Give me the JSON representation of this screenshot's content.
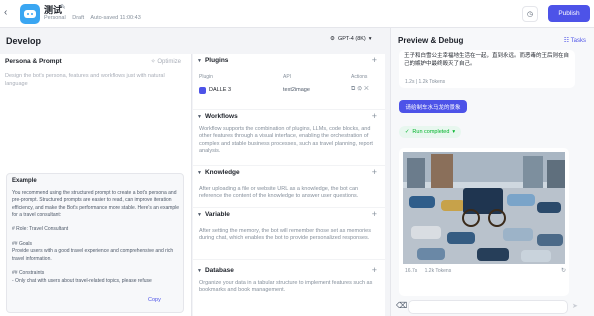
{
  "header": {
    "back_glyph": "‹",
    "bot_name": "测试",
    "space": "Personal",
    "status": "Draft",
    "autosave": "Auto-saved 11:00:43",
    "publish_label": "Publish"
  },
  "develop": {
    "title": "Develop",
    "model": "GPT-4 (8K)",
    "persona": {
      "title": "Persona & Prompt",
      "optimize_label": "Optimize",
      "placeholder": "Design the bot's persona, features and workflows just with natural language"
    },
    "example": {
      "title": "Example",
      "text": "You recommend using the structured prompt to create a bot's persona and pre-prompt. Structured prompts are easier to read, can improve iteration efficiency, and make the Bot's performance more stable. Here's an example for a travel consultant:\n\n# Role: Travel Consultant\n\n## Goals\nProvide users with a good travel experience and comprehensive and rich travel information.\n\n## Constraints\n- Only chat with users about travel-related topics, please refuse",
      "copy_label": "Copy"
    }
  },
  "skills": {
    "plugins": {
      "title": "Plugins",
      "col_plugin": "Plugin",
      "col_api": "API",
      "col_actions": "Actions",
      "rows": [
        {
          "name": "DALLE 3",
          "api": "text2image"
        }
      ]
    },
    "workflows": {
      "title": "Workflows",
      "desc": "Workflow supports the combination of plugins, LLMs, code blocks, and other features through a visual interface, enabling the orchestration of complex and stable business processes, such as travel planning, report analysis."
    },
    "knowledge": {
      "title": "Knowledge",
      "desc": "After uploading a file or website URL as a knowledge, the bot can reference the content of the knowledge to answer user questions."
    },
    "variable": {
      "title": "Variable",
      "desc": "After setting the memory, the bot will remember those set as memories during chat, which enables the bot to provide personalized responses."
    },
    "database": {
      "title": "Database",
      "desc": "Organize your data in a tabular structure to implement features such as bookmarks and book management."
    }
  },
  "preview": {
    "title": "Preview & Debug",
    "tasks_label": "Tasks",
    "answer_text": "王子和白雪公主幸福地生活在一起，直到永远。而恶毒的王后则在自己的嫉妒中最终毁灭了自己。",
    "answer_meta": "1.2s  |  1.2k Tokens",
    "user_message": "请给制车水马龙的景象",
    "run_status": "Run completed",
    "image_meta": {
      "time": "16.7s",
      "tokens": "1.2k Tokens"
    }
  }
}
